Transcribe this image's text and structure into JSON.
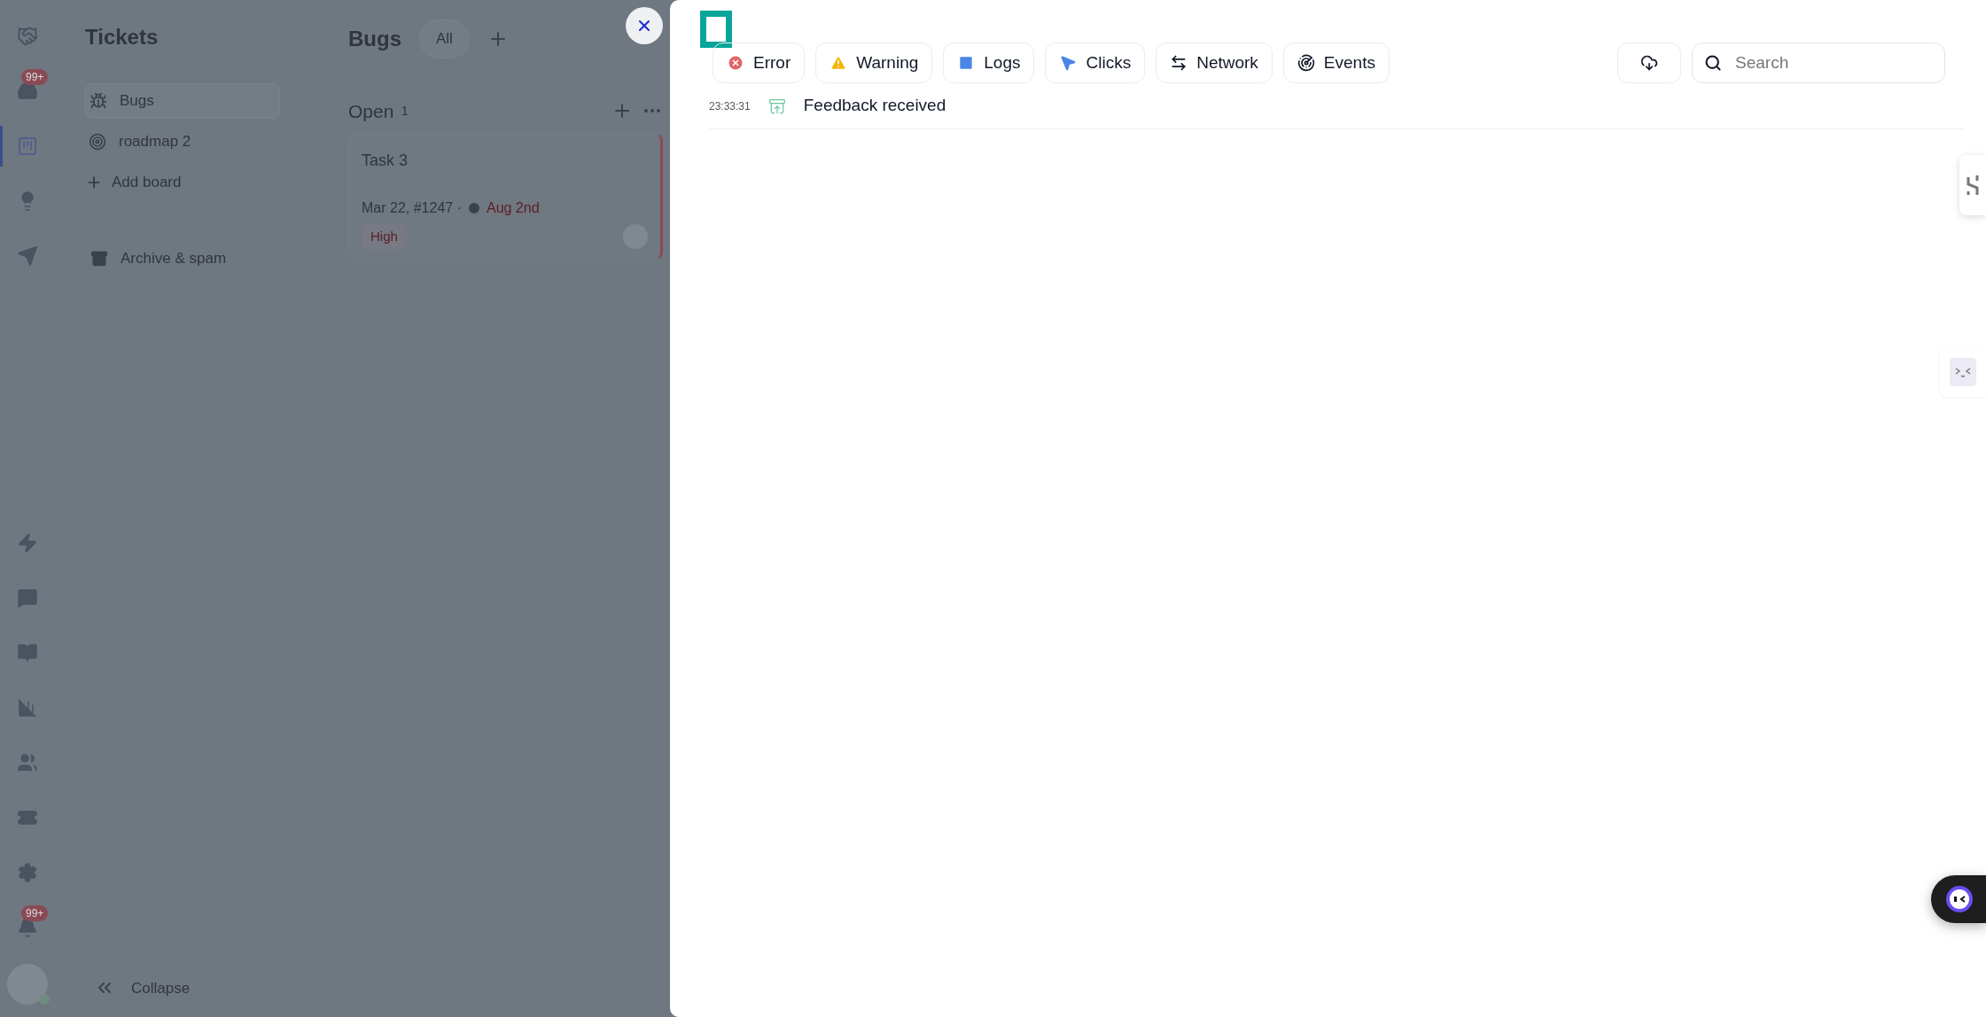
{
  "rail": {
    "top": [
      {
        "kind": "logo",
        "selected": false
      },
      {
        "kind": "inbox",
        "badge": "99+",
        "selected": false
      },
      {
        "kind": "board",
        "selected": true
      },
      {
        "kind": "idea",
        "selected": false
      },
      {
        "kind": "send",
        "selected": false
      }
    ],
    "bottom": [
      {
        "kind": "bolt",
        "selected": false
      },
      {
        "kind": "chat",
        "selected": false
      },
      {
        "kind": "book",
        "selected": false
      },
      {
        "kind": "chart",
        "selected": false
      },
      {
        "kind": "people",
        "selected": false
      },
      {
        "kind": "ticket",
        "selected": false
      },
      {
        "kind": "settings",
        "selected": false
      },
      {
        "kind": "bell",
        "badge": "99+",
        "selected": false
      }
    ]
  },
  "tickets_sidebar": {
    "title": "Tickets",
    "boards": [
      {
        "label": "Bugs",
        "kind": "bug",
        "selected": true
      },
      {
        "label": "roadmap 2",
        "kind": "target",
        "selected": false
      }
    ],
    "add_board": "Add board",
    "archive": "Archive & spam",
    "collapse": "Collapse"
  },
  "board": {
    "title": "Bugs",
    "views": [
      {
        "label": "All",
        "selected": true
      }
    ],
    "column": {
      "title": "Open",
      "count": "1",
      "cards": [
        {
          "title": "Task 3",
          "meta": "Mar 22, #1247 ·",
          "due": "Aug 2nd",
          "priority": "High"
        }
      ]
    }
  },
  "panel": {
    "filters": [
      {
        "label": "Error",
        "kind": "error"
      },
      {
        "label": "Warning",
        "kind": "warning"
      },
      {
        "label": "Logs",
        "kind": "logs"
      },
      {
        "label": "Clicks",
        "kind": "clicks"
      },
      {
        "label": "Network",
        "kind": "network"
      },
      {
        "label": "Events",
        "kind": "events"
      }
    ],
    "search": {
      "placeholder": "Search"
    },
    "events": [
      {
        "time": "23:33:31",
        "text": "Feedback received",
        "kind": "feedback"
      }
    ]
  }
}
